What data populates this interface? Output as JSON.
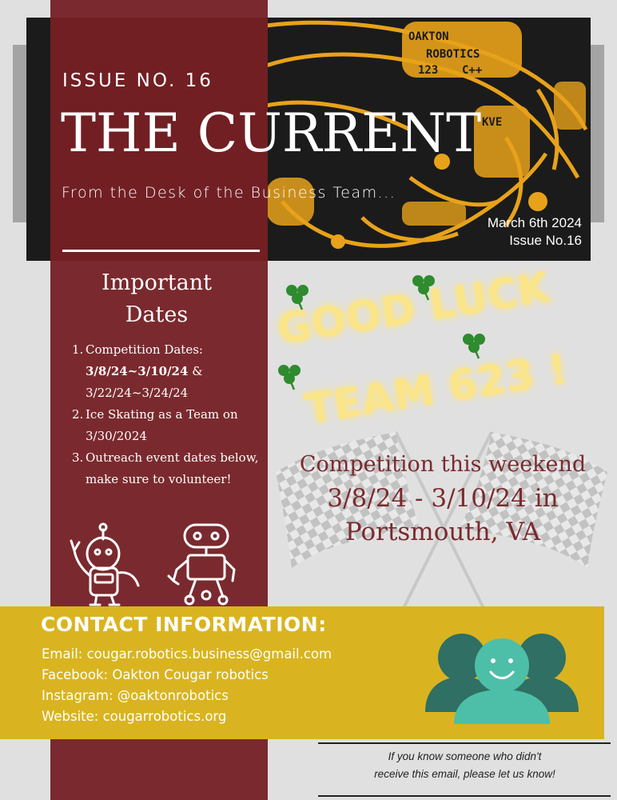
{
  "header": {
    "issue_label": "ISSUE NO. 16",
    "title": "THE CURRENT",
    "subtitle": "From the Desk of the Business Team...",
    "date": "March 6th 2024",
    "issue": "Issue No.16",
    "artwork_text": [
      "OAKTON",
      "ROBOTICS",
      "C++",
      "KVE",
      "123"
    ]
  },
  "important_dates": {
    "heading_line1": "Important",
    "heading_line2": "Dates",
    "items": [
      {
        "num": "1.",
        "label": "Competition Dates:",
        "bold_dates": "3/8/24~3/10/24",
        "connector": " &",
        "second_dates": "3/22/24~3/24/24"
      },
      {
        "num": "2.",
        "line1": "Ice Skating as a Team on",
        "line2": "3/30/2024"
      },
      {
        "num": "3.",
        "line1": "Outreach event dates below,",
        "line2": "make sure to volunteer!"
      }
    ]
  },
  "banner": {
    "line1": "GOOD LUCK",
    "line2": "TEAM 623 !"
  },
  "competition": {
    "line1": "Competition this weekend",
    "line2": "3/8/24 - 3/10/24 in",
    "line3": "Portsmouth, VA"
  },
  "contact": {
    "title": "CONTACT INFORMATION:",
    "email": "Email: cougar.robotics.business@gmail.com",
    "facebook": "Facebook: Oakton Cougar robotics",
    "instagram": "Instagram: @oaktonrobotics",
    "website": "Website: cougarrobotics.org"
  },
  "footer": {
    "line1": "If you know someone who didn't",
    "line2": "receive this email, please let us know!"
  },
  "colors": {
    "maroon": "#7a2a2e",
    "gold": "#d9b420",
    "teal_dark": "#2f6f64",
    "teal_light": "#4dbfa8",
    "banner_yellow": "#fbe58a",
    "clover": "#2e8b2e"
  },
  "icons": [
    "cougar-artwork-icon",
    "robot-icon",
    "clover-icon",
    "checkered-flag-icon",
    "people-icon"
  ]
}
